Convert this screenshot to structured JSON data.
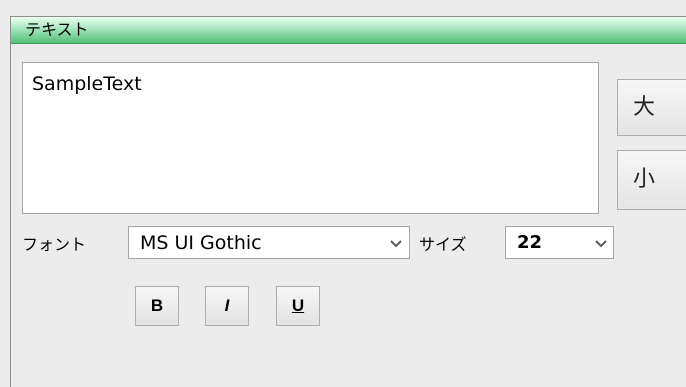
{
  "panel": {
    "title": "テキスト"
  },
  "editor": {
    "text": "SampleText"
  },
  "size_buttons": {
    "larger_label": "大",
    "smaller_label": "小"
  },
  "font": {
    "label": "フォント",
    "selected": "MS UI Gothic"
  },
  "size": {
    "label": "サイズ",
    "selected": "22"
  },
  "style_buttons": {
    "bold_label": "B",
    "italic_label": "I",
    "underline_label": "U"
  },
  "colors": {
    "header_gradient_top": "#eafff0",
    "header_gradient_bottom": "#55bf7b",
    "panel_background": "#ececec"
  }
}
